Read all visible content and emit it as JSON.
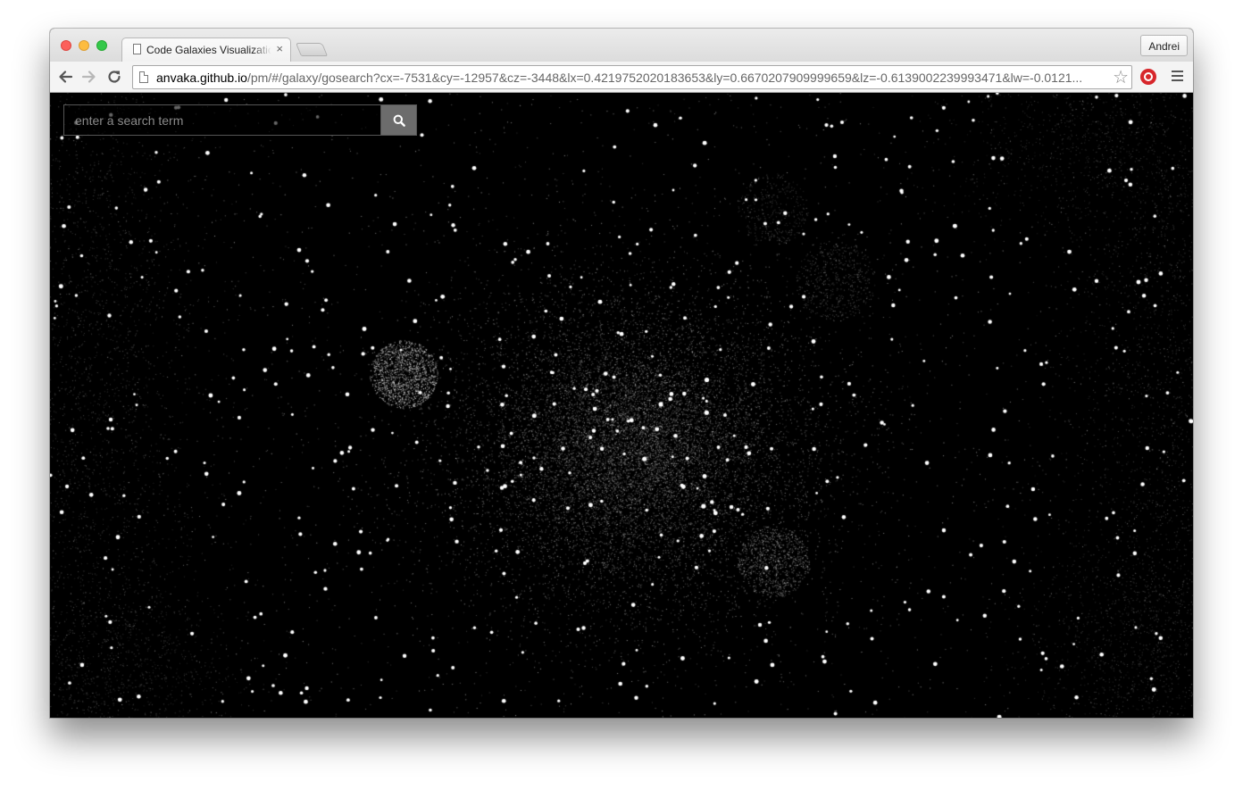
{
  "browser": {
    "tab_title": "Code Galaxies Visualization",
    "tab_close": "×",
    "profile_name": "Andrei",
    "url_host": "anvaka.github.io",
    "url_path": "/pm/#/galaxy/gosearch?cx=-7531&cy=-12957&cz=-3448&lx=0.4219752020183653&ly=0.6670207909999659&lz=-0.6139002239993471&lw=-0.0121..."
  },
  "search": {
    "placeholder": "enter a search term"
  },
  "colors": {
    "background": "#000000",
    "star": "#ffffff",
    "search_button": "#6c6c6c"
  },
  "icons": {
    "back": "arrow-left-icon",
    "forward": "arrow-right-icon",
    "reload": "reload-icon",
    "bookmark": "star-icon",
    "extension": "stop-sign-icon",
    "menu": "hamburger-icon",
    "search": "magnifier-icon"
  }
}
